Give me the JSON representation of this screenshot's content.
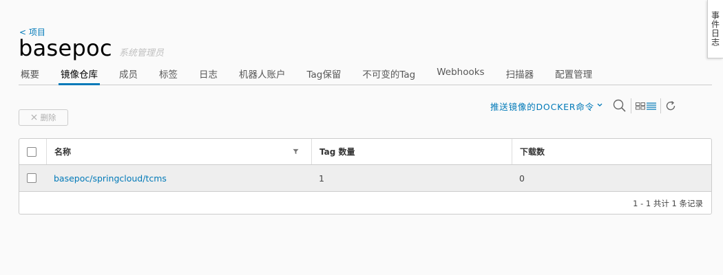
{
  "nav": {
    "back_label": "< 项目"
  },
  "project": {
    "name": "basepoc",
    "role": "系统管理员"
  },
  "tabs": [
    {
      "label": "概要",
      "active": false
    },
    {
      "label": "镜像仓库",
      "active": true
    },
    {
      "label": "成员",
      "active": false
    },
    {
      "label": "标签",
      "active": false
    },
    {
      "label": "日志",
      "active": false
    },
    {
      "label": "机器人账户",
      "active": false
    },
    {
      "label": "Tag保留",
      "active": false
    },
    {
      "label": "不可变的Tag",
      "active": false
    },
    {
      "label": "Webhooks",
      "active": false
    },
    {
      "label": "扫描器",
      "active": false
    },
    {
      "label": "配置管理",
      "active": false
    }
  ],
  "event_log": {
    "label": "事件日志"
  },
  "toolbar": {
    "delete_label": "删除",
    "push_cmd_label": "推送镜像的DOCKER命令"
  },
  "grid": {
    "columns": {
      "name": "名称",
      "tag_count": "Tag 数量",
      "pull_count": "下载数"
    },
    "rows": [
      {
        "name": "basepoc/springcloud/tcms",
        "tag_count": "1",
        "pull_count": "0"
      }
    ],
    "footer": "1 - 1 共计 1 条记录"
  },
  "colors": {
    "accent": "#0079b8",
    "row_bg": "#eeeeee",
    "border": "#cccccc"
  },
  "icons": [
    "close-icon",
    "chevron-down-icon",
    "search-icon",
    "card-view-icon",
    "list-view-icon",
    "refresh-icon",
    "filter-icon"
  ]
}
